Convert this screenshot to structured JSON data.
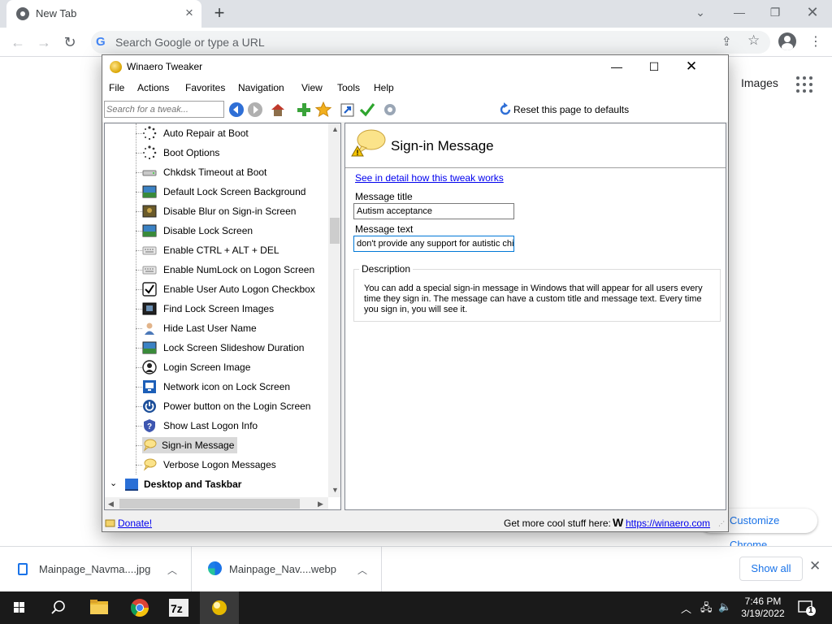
{
  "chrome": {
    "tab_title": "New Tab",
    "omnibox_placeholder": "Search Google or type a URL",
    "images_link": "Images",
    "customize_button": "Customize Chrome"
  },
  "downloads": {
    "items": [
      {
        "name": "Mainpage_Navma....jpg"
      },
      {
        "name": "Mainpage_Nav....webp"
      }
    ],
    "show_all": "Show all"
  },
  "taskbar": {
    "time": "7:46 PM",
    "date": "3/19/2022",
    "notification_count": "1"
  },
  "winaero": {
    "title": "Winaero Tweaker",
    "menu": [
      "File",
      "Actions",
      "Favorites",
      "Navigation",
      "View",
      "Tools",
      "Help"
    ],
    "search_placeholder": "Search for a tweak...",
    "reset_label": "Reset this page to defaults",
    "tree": {
      "items": [
        {
          "label": "Auto Repair at Boot",
          "icon": "spinner-icon"
        },
        {
          "label": "Boot Options",
          "icon": "spinner-icon"
        },
        {
          "label": "Chkdsk Timeout at Boot",
          "icon": "drive-icon"
        },
        {
          "label": "Default Lock Screen Background",
          "icon": "landscape-icon"
        },
        {
          "label": "Disable Blur on Sign-in Screen",
          "icon": "landscape-icon"
        },
        {
          "label": "Disable Lock Screen",
          "icon": "landscape-icon"
        },
        {
          "label": "Enable CTRL + ALT + DEL",
          "icon": "keyboard-icon"
        },
        {
          "label": "Enable NumLock on Logon Screen",
          "icon": "keyboard-icon"
        },
        {
          "label": "Enable User Auto Logon Checkbox",
          "icon": "checkbox-icon"
        },
        {
          "label": "Find Lock Screen Images",
          "icon": "landscape-icon"
        },
        {
          "label": "Hide Last User Name",
          "icon": "user-icon"
        },
        {
          "label": "Lock Screen Slideshow Duration",
          "icon": "landscape-icon"
        },
        {
          "label": "Login Screen Image",
          "icon": "user-circle-icon"
        },
        {
          "label": "Network icon on Lock Screen",
          "icon": "monitor-icon"
        },
        {
          "label": "Power button on the Login Screen",
          "icon": "power-icon"
        },
        {
          "label": "Show Last Logon Info",
          "icon": "shield-question-icon"
        },
        {
          "label": "Sign-in Message",
          "icon": "speech-bubble-icon",
          "selected": true
        },
        {
          "label": "Verbose Logon Messages",
          "icon": "speech-bubble-icon"
        }
      ],
      "category": "Desktop and Taskbar"
    },
    "detail": {
      "title": "Sign-in Message",
      "link": "See in detail how this tweak works",
      "message_title_label": "Message title",
      "message_title_value": "Autism acceptance",
      "message_text_label": "Message text",
      "message_text_value": "don't provide any support for autistic chi",
      "description_label": "Description",
      "description_text": "You can add a special sign-in message in Windows that will appear for all users every time they sign in. The message can have a custom title and message text. Every time you sign in, you will see it."
    },
    "status": {
      "donate": "Donate!",
      "get_more": "Get more cool stuff here:",
      "winaero_url": "https://winaero.com"
    }
  }
}
